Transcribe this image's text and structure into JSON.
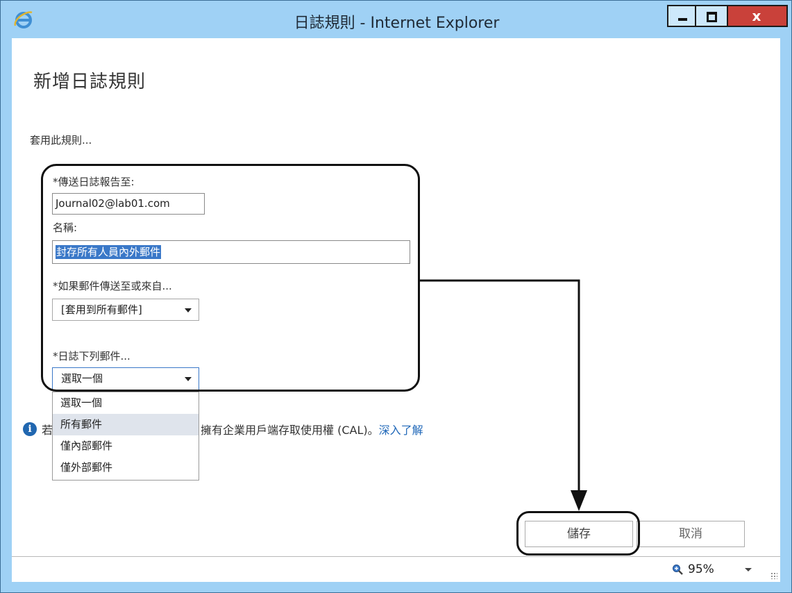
{
  "window": {
    "title": "日誌規則 - Internet Explorer",
    "close_label": "x"
  },
  "page": {
    "title": "新增日誌規則",
    "intro": "套用此規則..."
  },
  "form": {
    "send_to_label": "*傳送日誌報告至:",
    "send_to_value": "Journal02@lab01.com",
    "name_label": "名稱:",
    "name_value": "封存所有人員內外郵件",
    "if_sent_label": "*如果郵件傳送至或來自...",
    "if_sent_value": "[套用到所有郵件]",
    "journal_label": "*日誌下列郵件...",
    "journal_value": "選取一個",
    "journal_options": [
      "選取一個",
      "所有郵件",
      "僅內部郵件",
      "僅外部郵件"
    ],
    "journal_hover_index": 1
  },
  "info": {
    "prefix": "若",
    "text": "擁有企業用戶端存取使用權 (CAL)。",
    "link": "深入了解"
  },
  "buttons": {
    "save": "儲存",
    "cancel": "取消"
  },
  "status": {
    "zoom": "95%"
  },
  "colors": {
    "titlebar": "#9fd1f5",
    "close": "#c9413a",
    "selection": "#3a78c8",
    "link": "#1f67b8"
  }
}
